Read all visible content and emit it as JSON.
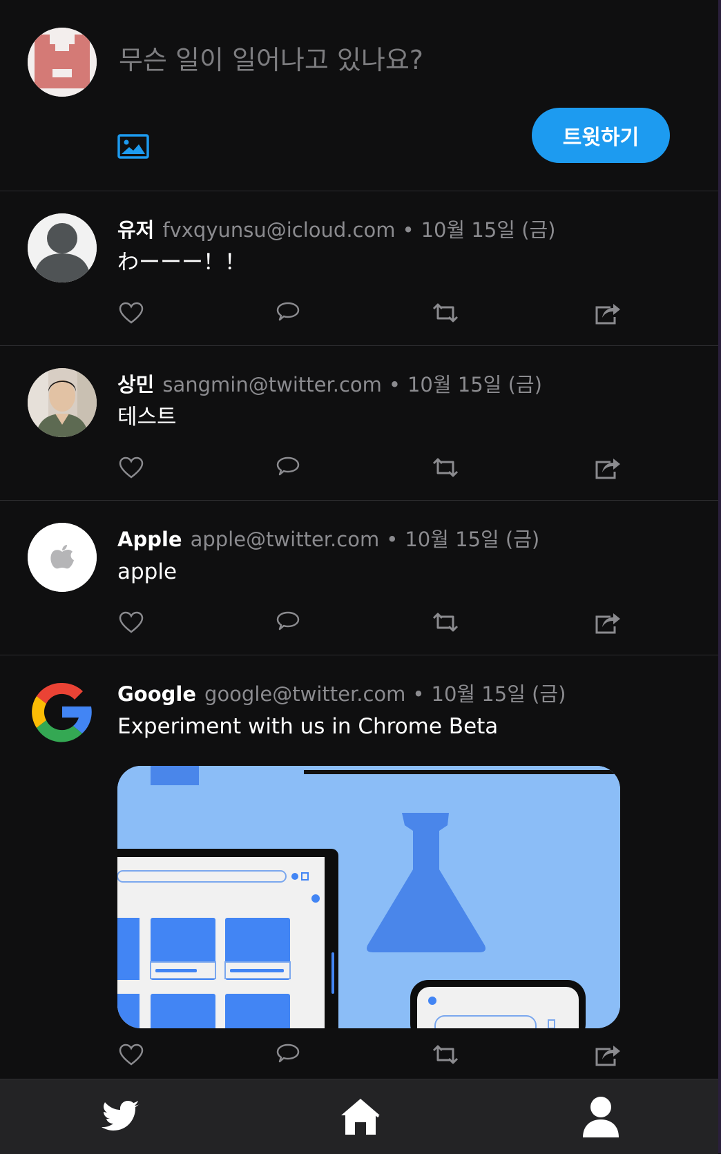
{
  "composer": {
    "placeholder": "무슨 일이 일어나고 있나요?",
    "tweet_button_label": "트윗하기"
  },
  "tweets": [
    {
      "name": "유저",
      "email": "fvxqyunsu@icloud.com",
      "separator": "•",
      "date": "10월 15일 (금)",
      "text": "わーーー！！",
      "avatar": "default-user-avatar"
    },
    {
      "name": "상민",
      "email": "sangmin@twitter.com",
      "separator": "•",
      "date": "10월 15일 (금)",
      "text": "테스트",
      "avatar": "person-photo-avatar"
    },
    {
      "name": "Apple",
      "email": "apple@twitter.com",
      "separator": "•",
      "date": "10월 15일 (금)",
      "text": "apple",
      "avatar": "apple-logo-avatar"
    },
    {
      "name": "Google",
      "email": "google@twitter.com",
      "separator": "•",
      "date": "10월 15일 (금)",
      "text": "Experiment with us in Chrome Beta",
      "avatar": "google-logo-avatar",
      "image": "chrome-beta-illustration"
    }
  ],
  "icons": {
    "like": "heart-icon",
    "reply": "comment-icon",
    "retweet": "retweet-icon",
    "share": "share-icon",
    "nav_home_logo": "twitter-bird-icon",
    "nav_home": "home-icon",
    "nav_profile": "user-icon"
  },
  "colors": {
    "background": "#0f0f10",
    "accent": "#1d9bf0",
    "muted_text": "#8b8b8f",
    "divider": "#2d2d30",
    "nav_bar": "#232325"
  }
}
